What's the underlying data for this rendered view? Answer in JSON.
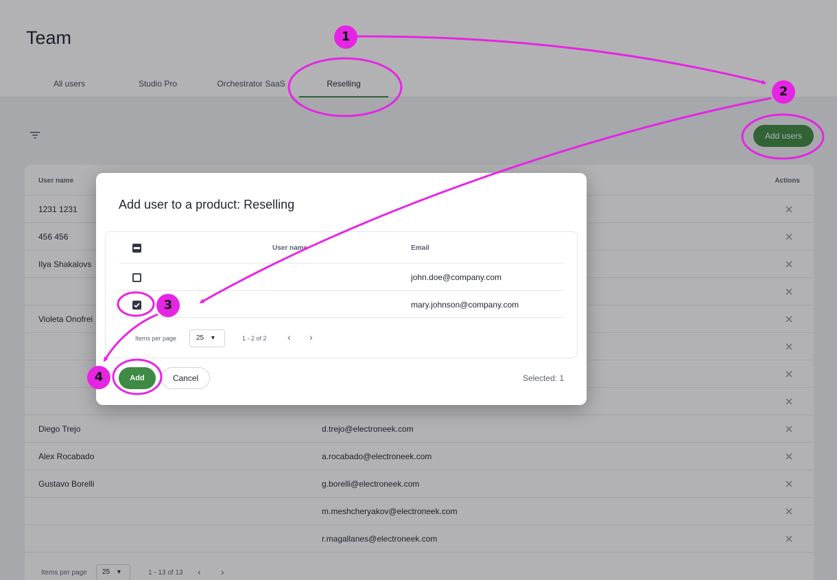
{
  "page": {
    "title": "Team"
  },
  "tabs": [
    {
      "label": "All users"
    },
    {
      "label": "Studio Pro"
    },
    {
      "label": "Orchestrator SaaS"
    },
    {
      "label": "Reselling"
    }
  ],
  "toolbar": {
    "filter_icon": "filter-icon",
    "add_users_label": "Add users"
  },
  "users_table": {
    "headers": {
      "name": "User name",
      "actions": "Actions"
    },
    "rows": [
      {
        "name": "1231 1231",
        "email": ""
      },
      {
        "name": "456 456",
        "email": ""
      },
      {
        "name": "Ilya Shakalovs",
        "email": ""
      },
      {
        "name": "",
        "email": ""
      },
      {
        "name": "Violeta Onofrei",
        "email": ""
      },
      {
        "name": "",
        "email": ""
      },
      {
        "name": "",
        "email": ""
      },
      {
        "name": "",
        "email": ""
      },
      {
        "name": "Diego Trejo",
        "email": "d.trejo@electroneek.com"
      },
      {
        "name": "Alex Rocabado",
        "email": "a.rocabado@electroneek.com"
      },
      {
        "name": "Gustavo Borelli",
        "email": "g.borelli@electroneek.com"
      },
      {
        "name": "",
        "email": "m.meshcheryakov@electroneek.com"
      },
      {
        "name": "",
        "email": "r.magallanes@electroneek.com"
      }
    ],
    "footer": {
      "items_per_page_label": "Items per page",
      "items_per_page": "25",
      "range": "1 - 13 of 13"
    }
  },
  "dialog": {
    "title": "Add user to a product: Reselling",
    "headers": {
      "name": "User name",
      "email": "Email"
    },
    "rows": [
      {
        "name": "",
        "email": "john.doe@company.com",
        "checked": false
      },
      {
        "name": "",
        "email": "mary.johnson@company.com",
        "checked": true
      }
    ],
    "pagination": {
      "items_per_page_label": "Items per page",
      "items_per_page": "25",
      "range": "1 - 2 of 2"
    },
    "add_label": "Add",
    "cancel_label": "Cancel",
    "selected_text": "Selected: 1"
  },
  "annotations": {
    "color": "#e625e4",
    "badges": [
      "1",
      "2",
      "3",
      "4"
    ]
  }
}
